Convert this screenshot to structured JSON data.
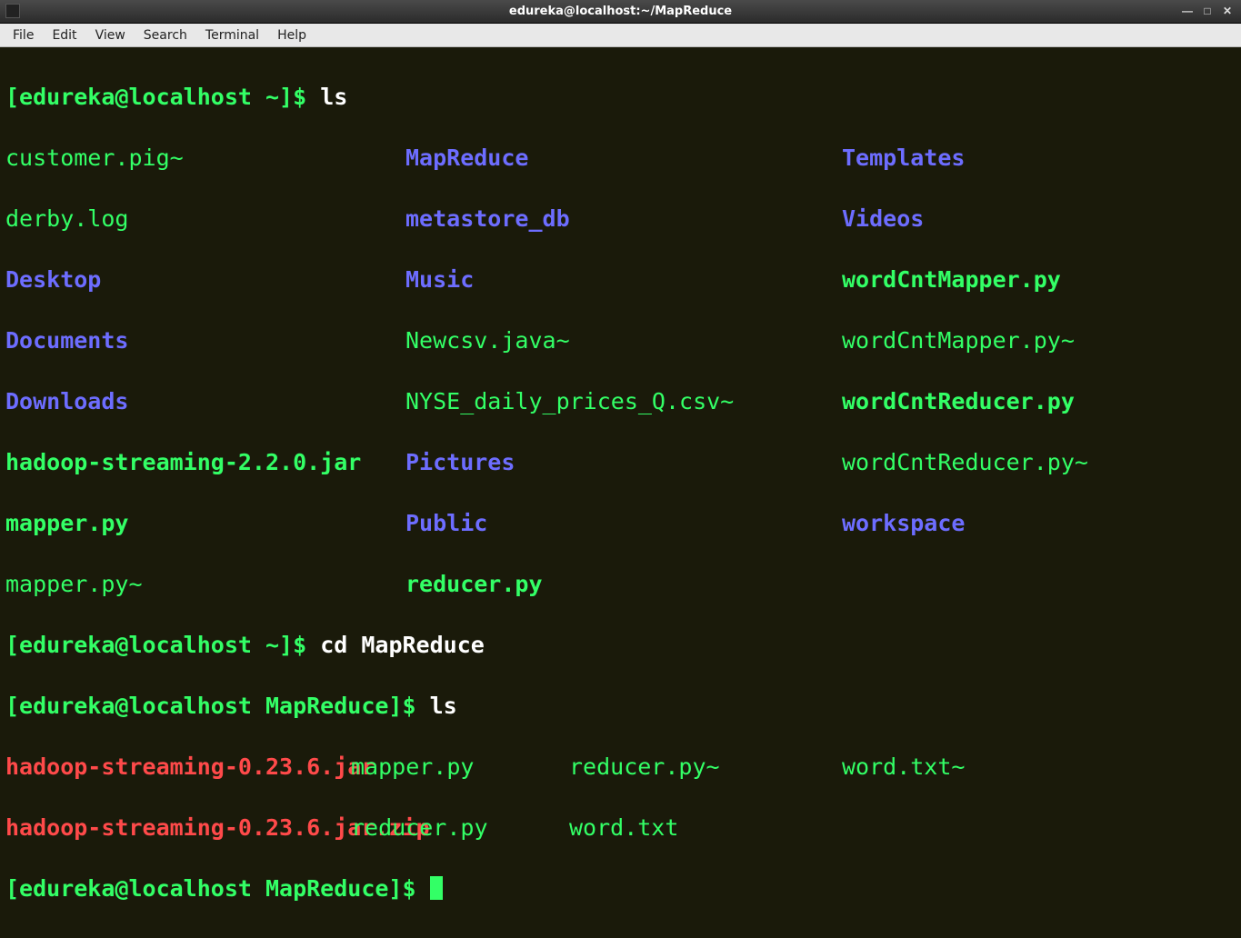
{
  "window": {
    "title": "edureka@localhost:~/MapReduce"
  },
  "menu": {
    "file": "File",
    "edit": "Edit",
    "view": "View",
    "search": "Search",
    "terminal": "Terminal",
    "help": "Help"
  },
  "prompt1": "[edureka@localhost ~]$ ",
  "cmd1": "ls",
  "ls1": {
    "r0": {
      "c0": "customer.pig~",
      "c1": "MapReduce",
      "c2": "Templates"
    },
    "r1": {
      "c0": "derby.log",
      "c1": "metastore_db",
      "c2": "Videos"
    },
    "r2": {
      "c0": "Desktop",
      "c1": "Music",
      "c2": "wordCntMapper.py"
    },
    "r3": {
      "c0": "Documents",
      "c1": "Newcsv.java~",
      "c2": "wordCntMapper.py~"
    },
    "r4": {
      "c0": "Downloads",
      "c1": "NYSE_daily_prices_Q.csv~",
      "c2": "wordCntReducer.py"
    },
    "r5": {
      "c0": "hadoop-streaming-2.2.0.jar",
      "c1": "Pictures",
      "c2": "wordCntReducer.py~"
    },
    "r6": {
      "c0": "mapper.py",
      "c1": "Public",
      "c2": "workspace"
    },
    "r7": {
      "c0": "mapper.py~",
      "c1": "reducer.py",
      "c2": ""
    }
  },
  "prompt2": "[edureka@localhost ~]$ ",
  "cmd2": "cd MapReduce",
  "prompt3": "[edureka@localhost MapReduce]$ ",
  "cmd3": "ls",
  "ls2": {
    "r0": {
      "c0": "hadoop-streaming-0.23.6.jar",
      "c1": "mapper.py",
      "c2": "reducer.py~",
      "c3": "word.txt~"
    },
    "r1": {
      "c0": "hadoop-streaming-0.23.6.jar.zip",
      "c1": "reducer.py",
      "c2": "word.txt",
      "c3": ""
    }
  },
  "prompt4": "[edureka@localhost MapReduce]$ "
}
